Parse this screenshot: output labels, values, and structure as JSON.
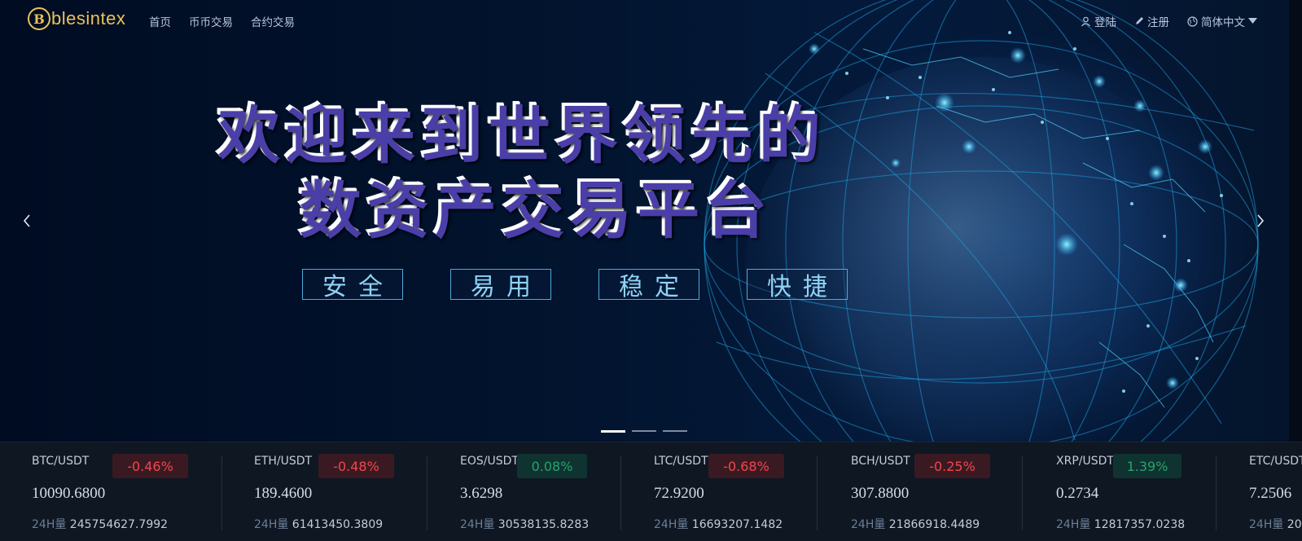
{
  "brand": {
    "logo_letter": "B",
    "name": "blesintex",
    "accent": "#e8c35a"
  },
  "nav": {
    "links": [
      "首页",
      "币币交易",
      "合约交易"
    ],
    "login": "登陆",
    "register": "注册",
    "language": "简体中文"
  },
  "hero": {
    "headline_line1": "欢迎来到世界领先的",
    "headline_line2": "数资产交易平台",
    "features": [
      "安全",
      "易用",
      "稳定",
      "快捷"
    ],
    "slides_count": 3,
    "active_slide": 1
  },
  "ticker": {
    "volume_label": "24H量",
    "items": [
      {
        "pair": "BTC/USDT",
        "change": "-0.46%",
        "direction": "down",
        "price": "10090.6800",
        "volume": "245754627.7992"
      },
      {
        "pair": "ETH/USDT",
        "change": "-0.48%",
        "direction": "down",
        "price": "189.4600",
        "volume": "61413450.3809"
      },
      {
        "pair": "EOS/USDT",
        "change": "0.08%",
        "direction": "up",
        "price": "3.6298",
        "volume": "30538135.8283"
      },
      {
        "pair": "LTC/USDT",
        "change": "-0.68%",
        "direction": "down",
        "price": "72.9200",
        "volume": "16693207.1482"
      },
      {
        "pair": "BCH/USDT",
        "change": "-0.25%",
        "direction": "down",
        "price": "307.8800",
        "volume": "21866918.4489"
      },
      {
        "pair": "XRP/USDT",
        "change": "1.39%",
        "direction": "up",
        "price": "0.2734",
        "volume": "12817357.0238"
      },
      {
        "pair": "ETC/USDT",
        "change": "",
        "direction": "",
        "price": "7.2506",
        "volume": "20"
      }
    ]
  },
  "colors": {
    "down": "#f2454e",
    "up": "#27a36c",
    "feature_border": "#4fa9d9"
  }
}
